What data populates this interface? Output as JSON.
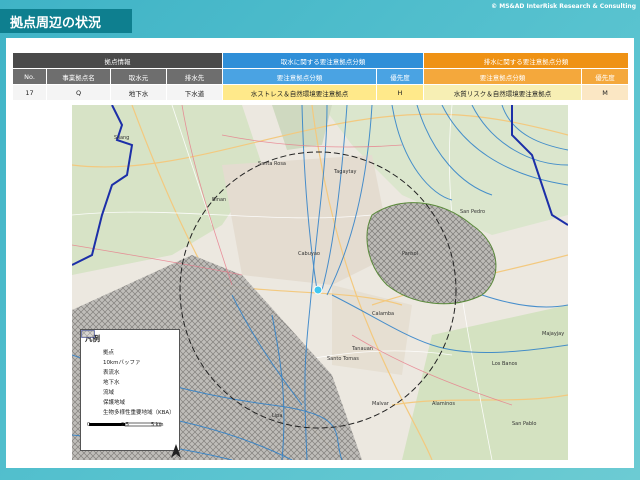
{
  "slide": {
    "title": "拠点周辺の状況",
    "copyright": "© MS&AD InterRisk Research & Consulting"
  },
  "table": {
    "group_headers": {
      "site_info": "拠点情報",
      "intake": "取水に関する要注意拠点分類",
      "discharge": "排水に関する要注意拠点分類"
    },
    "sub_headers": {
      "no": "No.",
      "site_name": "事業拠点名",
      "intake_source": "取水元",
      "discharge_dest": "排水先",
      "intake_class": "要注意拠点分類",
      "intake_priority": "優先度",
      "discharge_class": "要注意拠点分類",
      "discharge_priority": "優先度"
    },
    "row": {
      "no": "17",
      "site_name": "Q",
      "intake_source": "地下水",
      "discharge_dest": "下水道",
      "intake_class": "水ストレス＆自然環境要注意拠点",
      "intake_priority": "H",
      "discharge_class": "水質リスク＆自然環境要注意拠点",
      "discharge_priority": "M"
    }
  },
  "map": {
    "place_labels": [
      "Silang",
      "Tagaytay",
      "San Pedro",
      "Santa Rosa",
      "Binan",
      "Calamba",
      "Los Banos",
      "Alaminos",
      "San Pablo",
      "Tanauan",
      "Malvar",
      "Lipa",
      "Santo Tomas",
      "Cabuyao",
      "Pansol",
      "Majayjay"
    ],
    "legend": {
      "title": "凡例",
      "items": [
        {
          "key": "site",
          "label": "拠点"
        },
        {
          "key": "buffer",
          "label": "10kmバッファ"
        },
        {
          "key": "surface",
          "label": "表流水"
        },
        {
          "key": "ground",
          "label": "地下水"
        },
        {
          "key": "basin",
          "label": "流域"
        },
        {
          "key": "protected",
          "label": "保護地域"
        },
        {
          "key": "kba",
          "label": "生物多様性重要地域（KBA）"
        }
      ],
      "scale_labels": [
        "0",
        "2.5",
        "5 km"
      ],
      "north_label": "N"
    },
    "colors": {
      "site": "#3fc7f0",
      "surface_water": "#2b7fc9",
      "groundwater": "#e87a8a",
      "basin": "#1c2fa8",
      "hatch": "#7a7a7a"
    }
  }
}
